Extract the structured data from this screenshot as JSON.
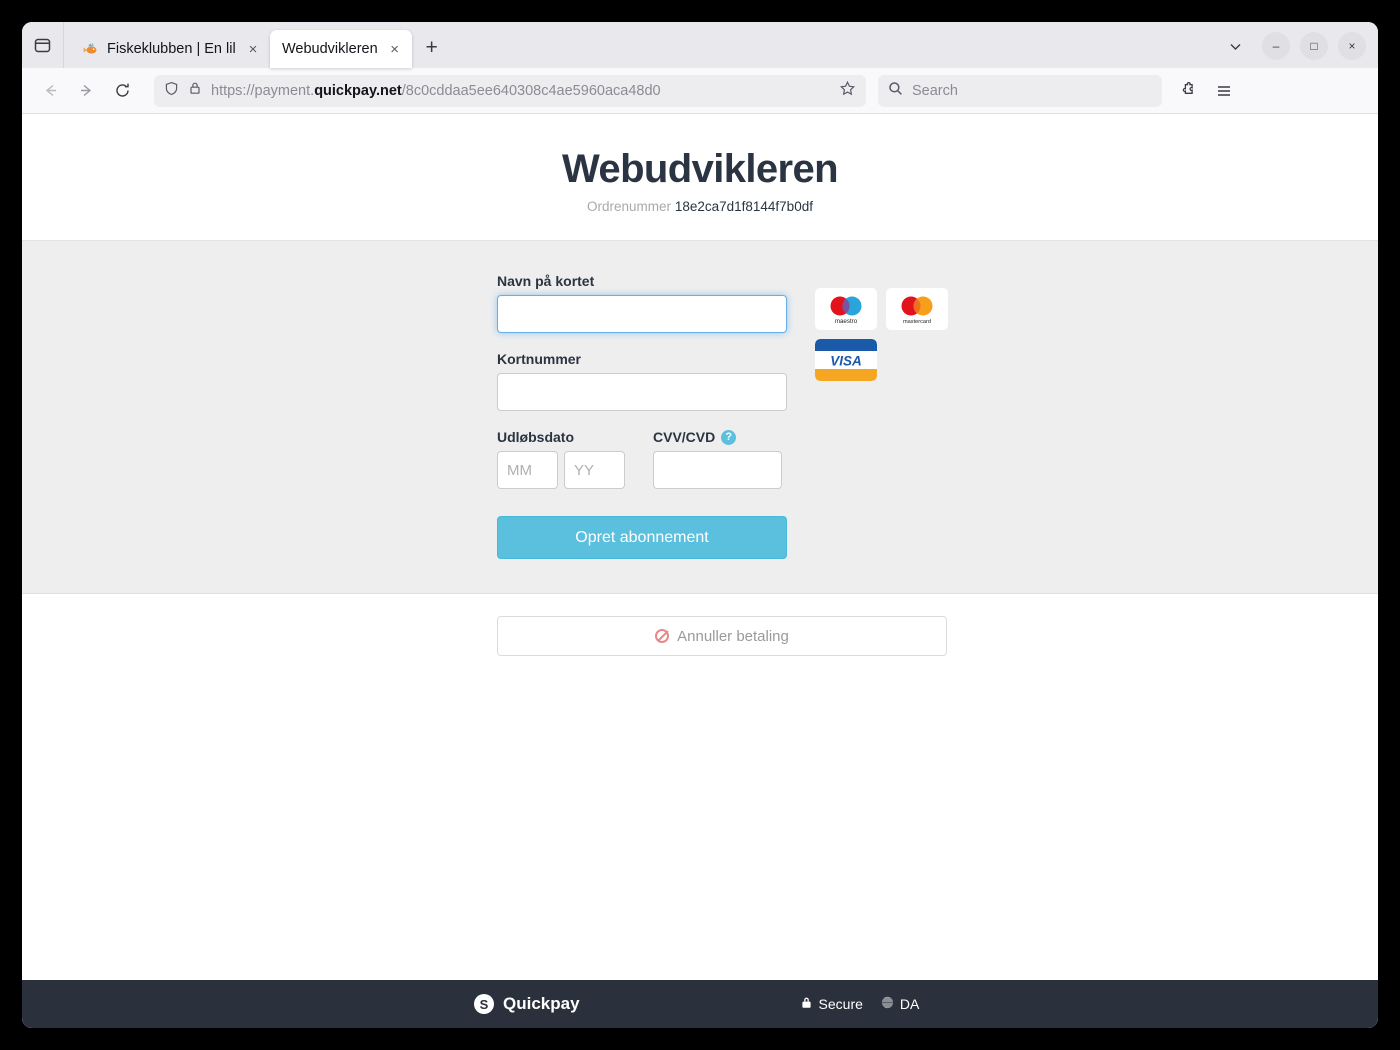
{
  "browser": {
    "tabs": [
      {
        "title": "Fiskeklubben | En lille lo",
        "favicon": "fish-icon",
        "active": false,
        "close_label": "×"
      },
      {
        "title": "Webudvikleren",
        "favicon": "none",
        "active": true,
        "close_label": "×"
      }
    ],
    "new_tab_label": "+",
    "sidebar_icon": "sidebar-icon",
    "tab_list_chevron": "chevron-down-icon",
    "window_controls": {
      "minimize": "–",
      "maximize": "□",
      "close": "×"
    },
    "nav": {
      "back": "←",
      "forward": "→",
      "reload": "↻"
    },
    "url": {
      "scheme": "https://",
      "subdomain": "payment.",
      "domain": "quickpay.net",
      "path": "/8c0cddaa5ee640308c4ae5960aca48d0",
      "shield_icon": "shield-icon",
      "lock_icon": "lock-icon",
      "bookmark_icon": "star-icon"
    },
    "search": {
      "placeholder": "Search",
      "icon": "search-icon"
    },
    "extensions_icon": "extensions-icon",
    "app_menu_icon": "hamburger-menu-icon"
  },
  "payment": {
    "shop_title": "Webudvikleren",
    "order_label": "Ordrenummer",
    "order_number": "18e2ca7d1f8144f7b0df",
    "form": {
      "name_label": "Navn på kortet",
      "name_value": "",
      "name_placeholder": "",
      "card_label": "Kortnummer",
      "card_value": "",
      "card_placeholder": "",
      "expiry_label": "Udløbsdato",
      "expiry_mm_placeholder": "MM",
      "expiry_mm_value": "",
      "expiry_yy_placeholder": "YY",
      "expiry_yy_value": "",
      "cvv_label": "CVV/CVD",
      "cvv_help_icon": "question-mark-icon",
      "cvv_value": "",
      "cvv_placeholder": "",
      "submit_label": "Opret abonnement"
    },
    "cards": [
      {
        "name": "maestro",
        "caption": "maestro"
      },
      {
        "name": "mastercard",
        "caption": "mastercard"
      },
      {
        "name": "visa",
        "caption": "VISA"
      }
    ],
    "cancel_label": "Annuller betaling",
    "cancel_icon": "ban-icon"
  },
  "footer": {
    "brand": "Quickpay",
    "brand_mark": "S",
    "secure_label": "Secure",
    "secure_icon": "lock-icon",
    "language_label": "DA",
    "language_icon": "globe-icon"
  },
  "colors": {
    "accent": "#5bc0de",
    "title": "#2b3442",
    "footer_bg": "#2b313c",
    "panel_bg": "#eeeeee",
    "cancel_red": "#e8888a"
  }
}
